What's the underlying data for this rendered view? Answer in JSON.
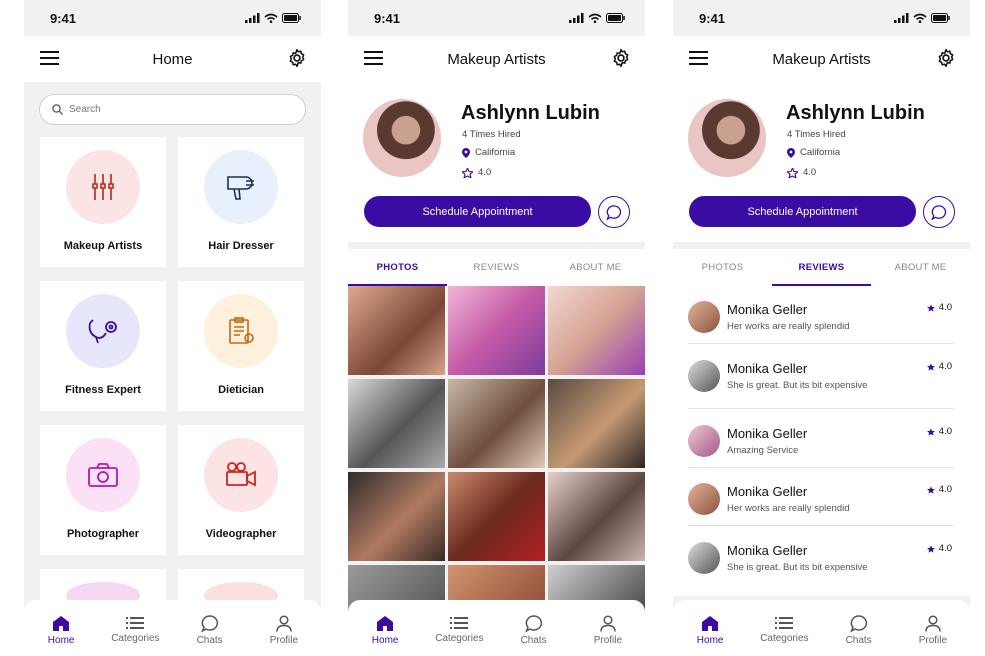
{
  "status": {
    "time": "9:41"
  },
  "home": {
    "title": "Home",
    "search_placeholder": "Search",
    "categories": [
      {
        "label": "Makeup Artists",
        "icon": "makeup-brushes-icon",
        "bg": "#fde4e4",
        "fg": "#b5281f"
      },
      {
        "label": "Hair Dresser",
        "icon": "hair-dryer-icon",
        "bg": "#e8f0fc",
        "fg": "#1f2d57"
      },
      {
        "label": "Fitness Expert",
        "icon": "stethoscope-icon",
        "bg": "#e7e7fb",
        "fg": "#3a0ca3"
      },
      {
        "label": "Dietician",
        "icon": "diet-clipboard-icon",
        "bg": "#fdf0dc",
        "fg": "#c06a15"
      },
      {
        "label": "Photographer",
        "icon": "camera-icon",
        "bg": "#fbe0f6",
        "fg": "#b01aa8"
      },
      {
        "label": "Videographer",
        "icon": "video-camera-icon",
        "bg": "#fde4e4",
        "fg": "#d12222"
      }
    ]
  },
  "artist": {
    "title": "Makeup Artists",
    "name": "Ashlynn Lubin",
    "hired": "4 Times Hired",
    "location": "California",
    "rating": "4.0",
    "schedule_label": "Schedule Appointment",
    "tabs": [
      "PHOTOS",
      "REVIEWS",
      "ABOUT ME"
    ]
  },
  "reviews": [
    {
      "name": "Monika Geller",
      "text": "Her works are really splendid",
      "rating": "4.0"
    },
    {
      "name": "Monika Geller",
      "text": "She is great. But its bit expensive",
      "rating": "4.0"
    },
    {
      "name": "Monika Geller",
      "text": "Amazing Service",
      "rating": "4.0"
    },
    {
      "name": "Monika Geller",
      "text": "Her works are really splendid",
      "rating": "4.0"
    },
    {
      "name": "Monika Geller",
      "text": "She is great. But its bit expensive",
      "rating": "4.0"
    }
  ],
  "nav": [
    "Home",
    "Categories",
    "Chats",
    "Profile"
  ],
  "colors": {
    "accent": "#3a0ca3",
    "bg": "#f1f1f1"
  }
}
